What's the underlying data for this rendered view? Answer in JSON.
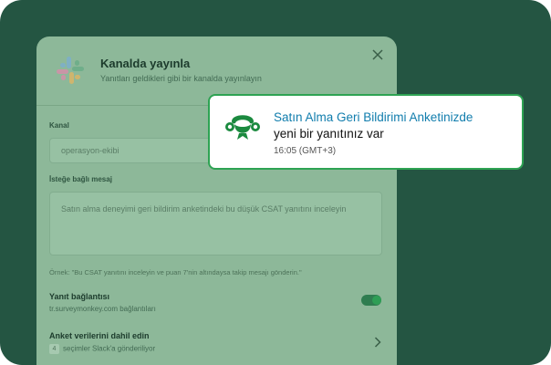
{
  "dialog": {
    "title": "Kanalda yayınla",
    "subtitle": "Yanıtları geldikleri gibi bir kanalda yayınlayın",
    "channel_label": "Kanal",
    "channel_value": "operasyon-ekibi",
    "message_label": "İsteğe bağlı mesaj",
    "message_value": "Satın alma deneyimi geri bildirim anketindeki bu düşük CSAT yanıtını inceleyin",
    "hint": "Örnek: \"Bu CSAT yanıtını inceleyin ve puan 7'nin altındaysa takip mesajı gönderin.\"",
    "reply_link_title": "Yanıt bağlantısı",
    "reply_link_sub": "tr.surveymonkey.com bağlantıları",
    "reply_link_enabled": true,
    "include_data_title": "Anket verilerini dahil edin",
    "include_data_count": "4",
    "include_data_sub": "seçimler Slack'a gönderiliyor"
  },
  "notification": {
    "title": "Satın Alma Geri Bildirimi Anketinizde",
    "line2": "yeni bir yanıtınız var",
    "time": "16:05 (GMT+3)"
  },
  "icons": {
    "app": "slack-logo-icon",
    "close": "close-icon",
    "chevron": "chevron-right-icon",
    "brand": "surveymonkey-logo-icon"
  },
  "colors": {
    "background": "#245542",
    "dialog": "#8db899",
    "notification_border": "#2ea353",
    "notification_title": "#117dad"
  }
}
